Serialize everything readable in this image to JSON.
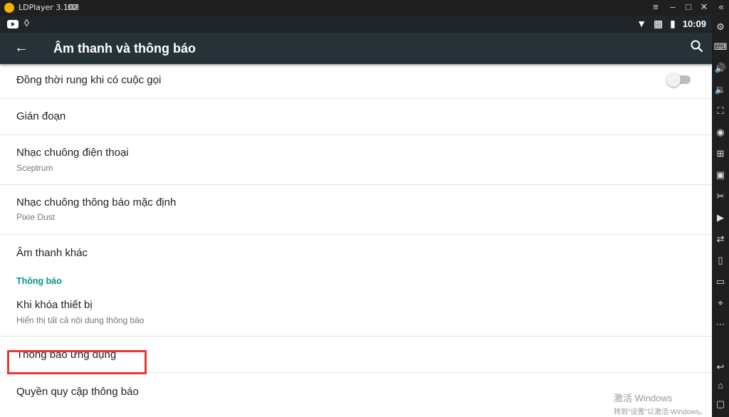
{
  "window": {
    "title": "LDPlayer 3.102",
    "controls": {
      "menu": "≡",
      "minimize": "–",
      "maximize": "□",
      "close": "✕",
      "extra": "«"
    }
  },
  "statusbar": {
    "time": "10:09",
    "icons": [
      "youtube-icon",
      "vpn-drop-icon",
      "wifi-icon",
      "no-sim-icon",
      "battery-icon"
    ]
  },
  "appbar": {
    "back": "←",
    "title": "Âm thanh và thông báo",
    "search": "⌕"
  },
  "settings": {
    "vibrate": {
      "title": "Đồng thời rung khi có cuộc gọi",
      "enabled": false
    },
    "interruptions": {
      "title": "Gián đoạn"
    },
    "ringtone": {
      "title": "Nhạc chuông điện thoại",
      "subtitle": "Sceptrum"
    },
    "default_notification": {
      "title": "Nhạc chuông thông báo mặc định",
      "subtitle": "Pixie Dust"
    },
    "other_sounds": {
      "title": "Âm thanh khác"
    },
    "section_notifications": "Thông báo",
    "lock_screen": {
      "title": "Khi khóa thiết bị",
      "subtitle": "Hiển thị tất cả nội dung thông báo"
    },
    "app_notifications": {
      "title": "Thông báo ứng dụng"
    },
    "notification_access": {
      "title": "Quyền quy cập thông báo"
    }
  },
  "highlight_color": "#e53935",
  "accent_color": "#009688",
  "watermark": {
    "line1": "激活 Windows",
    "line2": "转到\"设置\"以激活 Windows。"
  },
  "sidebar_icons": [
    "settings-icon",
    "keyboard-icon",
    "volume-up-icon",
    "volume-down-icon",
    "fullscreen-icon",
    "record-icon",
    "add-app-icon",
    "apk-icon",
    "cut-icon",
    "video-icon",
    "sync-icon",
    "rotate-icon",
    "screen-icon",
    "location-icon",
    "more-icon",
    "back-icon",
    "home-icon",
    "recent-icon"
  ]
}
